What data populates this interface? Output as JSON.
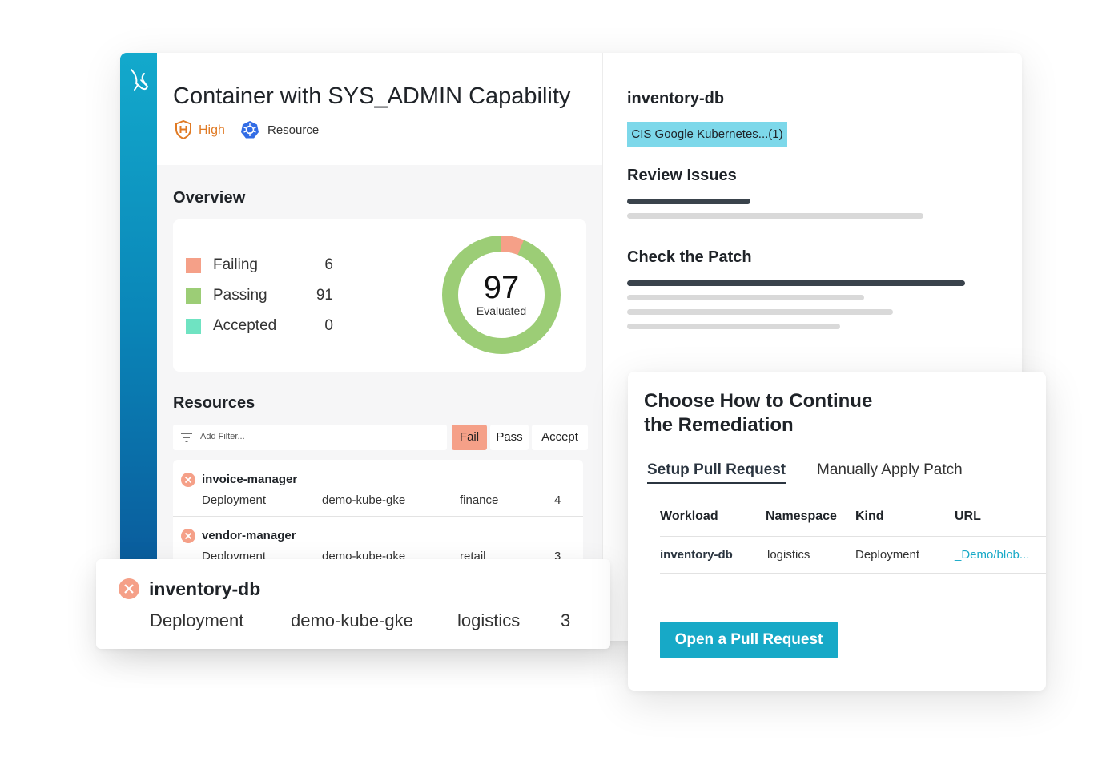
{
  "finding": {
    "title": "Container with SYS_ADMIN Capability",
    "severity": "High",
    "scope": "Resource"
  },
  "overview": {
    "title": "Overview",
    "legend": [
      {
        "label": "Failing",
        "value": "6",
        "color": "#f5a088"
      },
      {
        "label": "Passing",
        "value": "91",
        "color": "#9ccd76"
      },
      {
        "label": "Accepted",
        "value": "0",
        "color": "#6fe3c2"
      }
    ],
    "total": "97",
    "total_label": "Evaluated",
    "failing_count": 6,
    "passing_count": 91
  },
  "resources": {
    "title": "Resources",
    "filter_placeholder": "Add Filter...",
    "buttons": {
      "fail": "Fail",
      "pass": "Pass",
      "accept": "Accept"
    },
    "rows": [
      {
        "name": "invoice-manager",
        "kind": "Deployment",
        "cluster": "demo-kube-gke",
        "namespace": "finance",
        "count": "4"
      },
      {
        "name": "vendor-manager",
        "kind": "Deployment",
        "cluster": "demo-kube-gke",
        "namespace": "retail",
        "count": "3"
      }
    ]
  },
  "details": {
    "title": "inventory-db",
    "tag": "CIS Google Kubernetes...(1)",
    "review_title": "Review Issues",
    "patch_title": "Check the Patch"
  },
  "selected_resource": {
    "name": "inventory-db",
    "kind": "Deployment",
    "cluster": "demo-kube-gke",
    "namespace": "logistics",
    "count": "3"
  },
  "remediation": {
    "title_line1": "Choose How to Continue",
    "title_line2": "the Remediation",
    "tabs": {
      "pull_request": "Setup Pull Request",
      "manual": "Manually Apply Patch"
    },
    "columns": {
      "workload": "Workload",
      "namespace": "Namespace",
      "kind": "Kind",
      "url": "URL"
    },
    "row": {
      "workload": "inventory-db",
      "namespace": "logistics",
      "kind": "Deployment",
      "url": "_Demo/blob..."
    },
    "button": "Open a Pull Request"
  },
  "colors": {
    "accent": "#17a9c7",
    "failing": "#f5a088",
    "passing": "#9ccd76",
    "accepted": "#6fe3c2",
    "severity_high": "#e07a24",
    "tag_bg": "#7dd8ea"
  }
}
